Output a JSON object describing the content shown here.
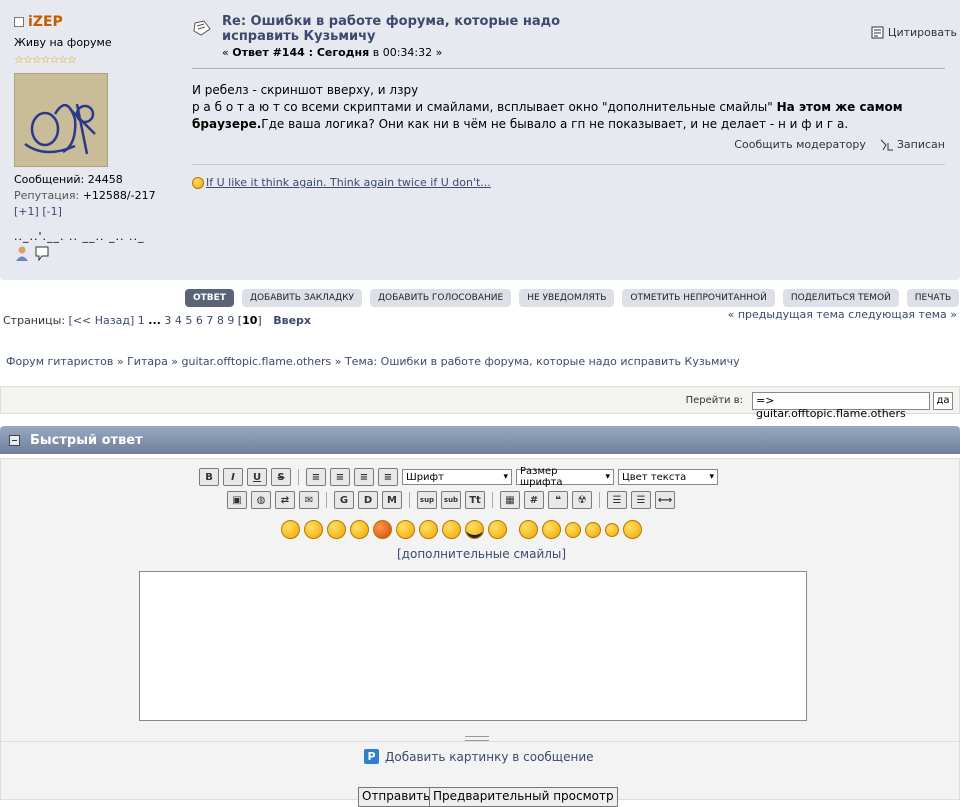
{
  "poster": {
    "name": "iZEP",
    "status": "Живу на форуме",
    "stars": "☆☆☆☆☆☆☆",
    "posts": "Сообщений: 24458",
    "rep_label": "Репутация:",
    "rep_value": "+12588/-217",
    "rate_plus": "[+1]",
    "rate_minus": "[-1]",
    "signature": ".._..'.__. .. __.. _.. .._"
  },
  "post": {
    "subject": "Re: Ошибки в работе форума, которые надо исправить Кузьмичу",
    "meta_prefix": "« ",
    "meta_bold": "Ответ #144 : Сегодня",
    "meta_suffix": " в 00:34:32 »",
    "quote": "Цитировать",
    "line1": "И  ребелз - скриншот вверху, и лзру",
    "line2a": "р а б о т а ю т со всеми скриптами и смайлами, всплывает окно \"дополнительные смайлы\" ",
    "line2b": "На этом же самом браузере.",
    "line2c": "Где ваша логика? Они как ни в чём не бывало а гп не показывает, и не делает - н и    ф и г а.",
    "report": "Сообщить модератору",
    "logged": "Записан",
    "sig_link": "If U like it think again. Think again twice if U don't..."
  },
  "actions": [
    "ОТВЕТ",
    "ДОБАВИТЬ ЗАКЛАДКУ",
    "ДОБАВИТЬ ГОЛОСОВАНИЕ",
    "НЕ УВЕДОМЛЯТЬ",
    "ОТМЕТИТЬ НЕПРОЧИТАННОЙ",
    "ПОДЕЛИТЬСЯ ТЕМОЙ",
    "ПЕЧАТЬ"
  ],
  "pagination": {
    "label": "Страницы: ",
    "back": "[<< Назад]",
    "first": "1",
    "dots": "...",
    "pages": [
      "3",
      "4",
      "5",
      "6",
      "7",
      "8",
      "9"
    ],
    "current": "10",
    "top": "Вверх",
    "prevnext": "« предыдущая тема следующая тема »"
  },
  "breadcrumb": "Форум гитаристов » Гитара » guitar.offtopic.flame.others » Тема: Ошибки в работе форума, которые надо исправить Кузьмичу",
  "jump": {
    "label": "Перейти в:",
    "value": "=> guitar.offtopic.flame.others",
    "go": "да"
  },
  "quick_reply": {
    "title": "Быстрый ответ",
    "font": "Шрифт",
    "size": "Размер шрифта",
    "color": "Цвет текста",
    "more_smileys": "[дополнительные смайлы]",
    "add_image": "Добавить картинку в сообщение",
    "send": "Отправить",
    "preview": "Предварительный просмотр"
  }
}
